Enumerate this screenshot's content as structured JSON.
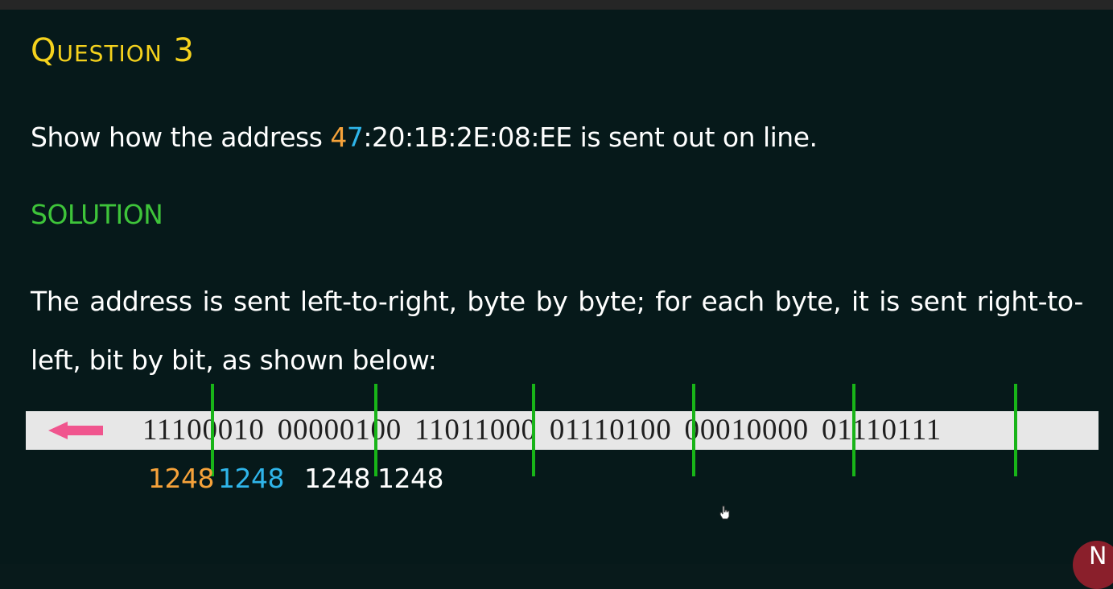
{
  "slide": {
    "title": "Question 3",
    "question": {
      "prefix": "Show how the address ",
      "highlight_first": "4",
      "highlight_second": "7",
      "suffix": ":20:1B:2E:08:EE is sent out on line."
    },
    "solution_heading": "SOLUTION",
    "explanation": "The address is sent left-to-right, byte by byte; for each byte, it is sent right-to-left, bit by bit, as shown below:",
    "bit_stream": "11100010 00000100 11011000 01110100 00010000 01110111",
    "direction_icon": "left-arrow-icon",
    "bit_weight_labels": [
      "1248",
      "1248",
      "1248",
      "1248"
    ],
    "colors": {
      "title": "#f5d21d",
      "solution": "#3ec43a",
      "highlight_orange": "#f6a23a",
      "highlight_blue": "#2fb5ea",
      "arrow": "#f0558e",
      "separator": "#18b418"
    }
  }
}
